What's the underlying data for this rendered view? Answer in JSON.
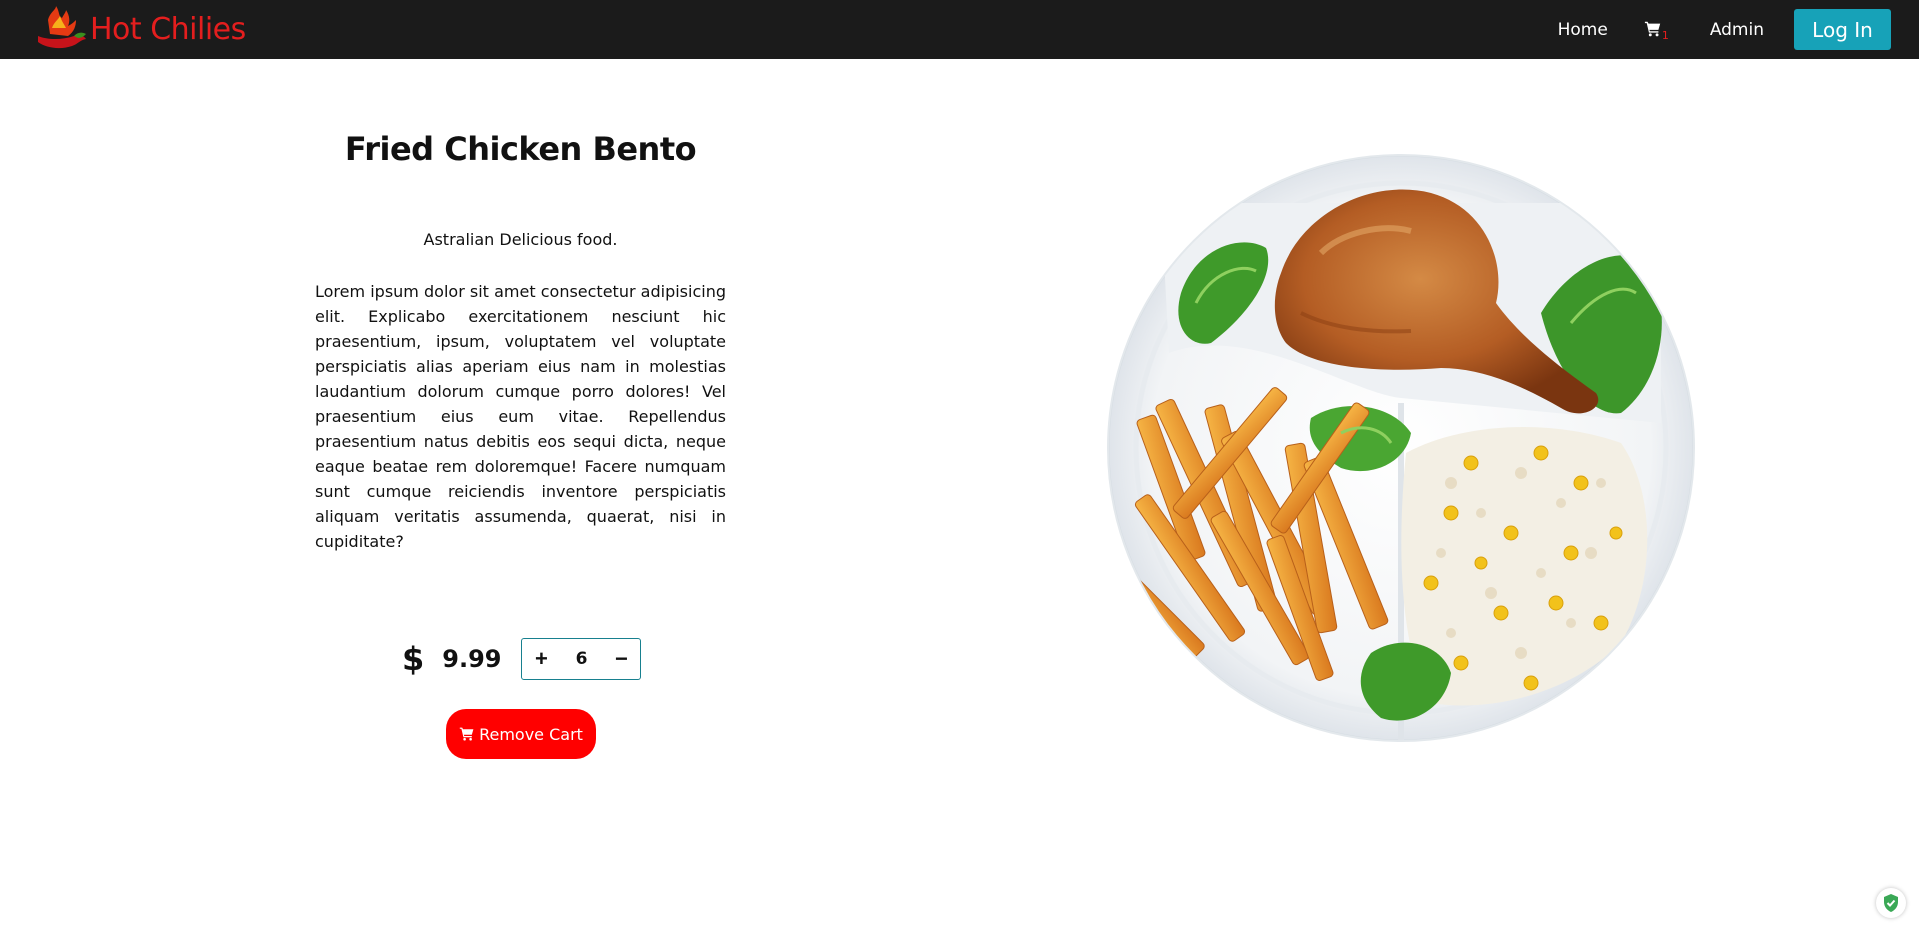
{
  "brand": {
    "name": "Hot Chilies",
    "color": "#e41e1e"
  },
  "nav": {
    "home_label": "Home",
    "cart_icon": "shopping-cart-icon",
    "cart_count": "1",
    "admin_label": "Admin",
    "login_label": "Log In",
    "login_color": "#17a2b8"
  },
  "product": {
    "title": "Fried Chicken Bento",
    "tagline": "Astralian Delicious food.",
    "description": "Lorem ipsum dolor sit amet consectetur adipisicing elit. Explicabo exercitationem nesciunt hic praesentium, ipsum, voluptatem vel voluptate perspiciatis alias aperiam eius nam in molestias laudantium dolorum cumque porro dolores! Vel praesentium eius eum vitae. Repellendus praesentium natus debitis eos sequi dicta, neque eaque beatae rem doloremque! Facere numquam sunt cumque reiciendis inventore perspiciatis aliquam veritatis assumenda, quaerat, nisi in cupiditate?",
    "currency": "$",
    "price": "9.99",
    "quantity": "6",
    "increment_label": "+",
    "decrement_label": "−",
    "remove_cart_label": "Remove Cart",
    "remove_cart_color": "#ff0000",
    "image_icon": "fried-chicken-bento-plate"
  }
}
